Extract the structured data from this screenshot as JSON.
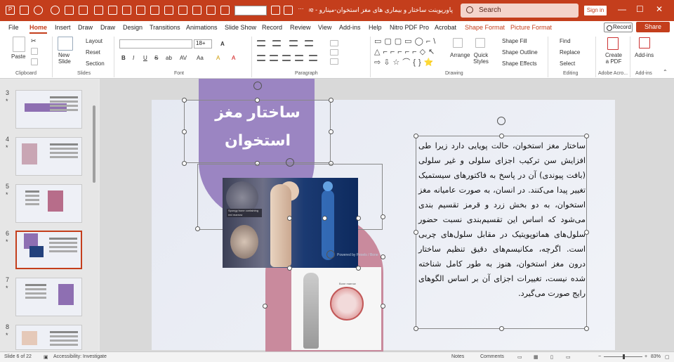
{
  "titlebar": {
    "doc_title": "پاورپوینت ساختار و بیماری های مغز استخوان-مینارو - Powe...",
    "search_placeholder": "Search",
    "signin_label": "Sign in",
    "min_glyph": "—",
    "max_glyph": "☐",
    "close_glyph": "✕"
  },
  "menu": {
    "tabs": [
      "File",
      "Home",
      "Insert",
      "Draw",
      "Draw",
      "Design",
      "Transitions",
      "Animations",
      "Slide Show",
      "Record",
      "Review",
      "View",
      "Add-ins",
      "Help",
      "Nitro PDF Pro",
      "Acrobat",
      "Shape Format",
      "Picture Format"
    ],
    "record_label": "Record",
    "share_label": "Share"
  },
  "ribbon": {
    "clipboard": {
      "paste": "Paste",
      "group": "Clipboard"
    },
    "slides": {
      "new_slide": "New Slide",
      "layout": "Layout",
      "reset": "Reset",
      "section": "Section",
      "group": "Slides"
    },
    "font": {
      "size": "18+",
      "group": "Font",
      "bold": "B",
      "italic": "I",
      "underline": "U",
      "strike": "S",
      "shadow": "ab",
      "spacing": "AV",
      "case": "Aa",
      "clear": "A",
      "highlight": "A",
      "color": "A"
    },
    "paragraph": {
      "group": "Paragraph"
    },
    "drawing": {
      "arrange": "Arrange",
      "quick_styles": "Quick Styles",
      "shape_fill": "Shape Fill",
      "shape_outline": "Shape Outline",
      "shape_effects": "Shape Effects",
      "group": "Drawing",
      "shapes": "▭▢▢▭◯⌐\\ △⌐⌐⌐⌐⌐◇↖ ⇨⇩☆⌒{}⭐"
    },
    "editing": {
      "find": "Find",
      "replace": "Replace",
      "select": "Select",
      "group": "Editing"
    },
    "acrobat": {
      "create_pdf": "Create a PDF",
      "group": "Adobe Acro..."
    },
    "addins": {
      "label": "Add-ins",
      "group": "Add-ins"
    }
  },
  "thumbnails": [
    {
      "num": "3",
      "star": "*"
    },
    {
      "num": "4",
      "star": "*"
    },
    {
      "num": "5",
      "star": "*"
    },
    {
      "num": "6",
      "star": "*"
    },
    {
      "num": "7",
      "star": "*"
    },
    {
      "num": "8",
      "star": "*"
    }
  ],
  "slide": {
    "title": "ساختار مغز استخوان",
    "image_label": "Spongy bone containing red marrow",
    "image_credit": "Powered by Pexels / Bone",
    "marrow_label": "Bone marrow",
    "body": "ساختار مغز استخوان، حالت پویایی دارد زیرا طی افزایش سن ترکیب اجزای سلولی و غیر سلولی (بافت پیوندی) آن در پاسخ به فاکتورهای سیستمیک تغییر پیدا می‌کنند. در انسان، به صورت عامیانه مغز استخوان، به دو بخش زرد و قرمز تقسیم بندی می‌شود که اساس این تقسیم‌بندی نسبت حضور سلول‌های هماتوپویتیک در مقابل سلول‌های چربی است. اگرچه، مکانیسم‌های دقیق تنظیم ساختار درون مغز استخوان، هنوز به طور کامل شناخته شده نیست، تغییرات اجزای آن بر اساس الگوهای رایج صورت می‌گیرد."
  },
  "status": {
    "slide_info": "Slide 6 of 22",
    "accessibility": "Accessibility: Investigate",
    "notes": "Notes",
    "comments": "Comments",
    "zoom": "83%"
  },
  "colors": {
    "accent": "#c43e1c",
    "purple": "#9b85c2",
    "pink": "#c98a9d"
  }
}
